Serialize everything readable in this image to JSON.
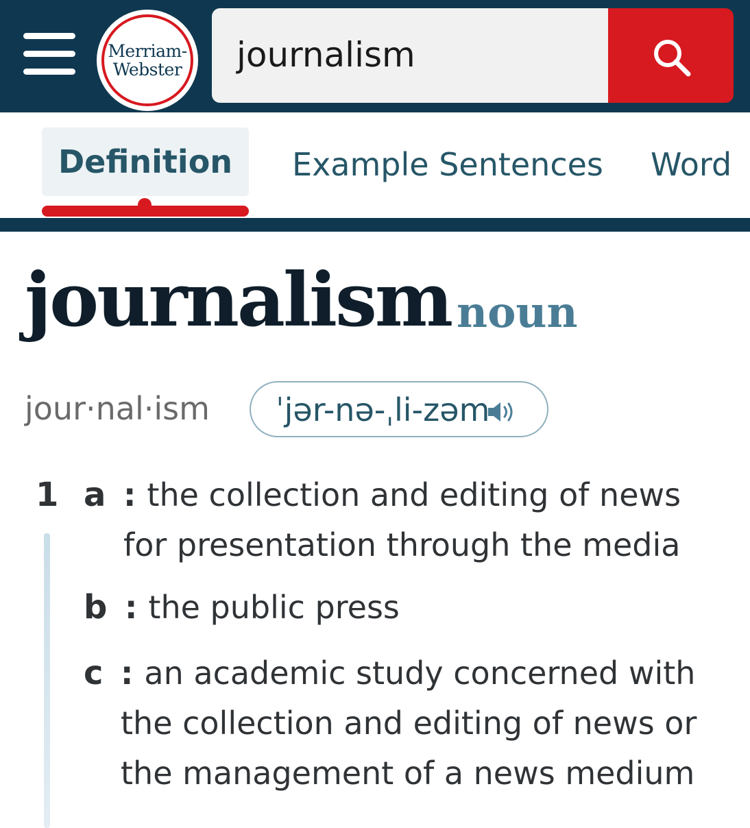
{
  "header": {
    "logo_line1": "Merriam-",
    "logo_line2": "Webster",
    "search_value": "journalism",
    "colors": {
      "header_bg": "#0f3850",
      "accent_red": "#d71920"
    }
  },
  "tabs": [
    {
      "label": "Definition",
      "active": true
    },
    {
      "label": "Example Sentences",
      "active": false
    },
    {
      "label": "Word",
      "active": false
    }
  ],
  "entry": {
    "headword": "journalism",
    "part_of_speech": "noun",
    "syllables": "jour·nal·ism",
    "pronunciation": "ˈjər-nə-ˌli-zəm",
    "senses": [
      {
        "number": "1",
        "subsenses": [
          {
            "letter": "a",
            "line1": "the collection and editing of news",
            "line2": "for presentation through the media"
          },
          {
            "letter": "b",
            "line1": "the public press"
          },
          {
            "letter": "c",
            "line1": "an academic study concerned with",
            "line2": "the collection and editing of news or",
            "line3": "the management of a news medium"
          }
        ]
      }
    ]
  }
}
